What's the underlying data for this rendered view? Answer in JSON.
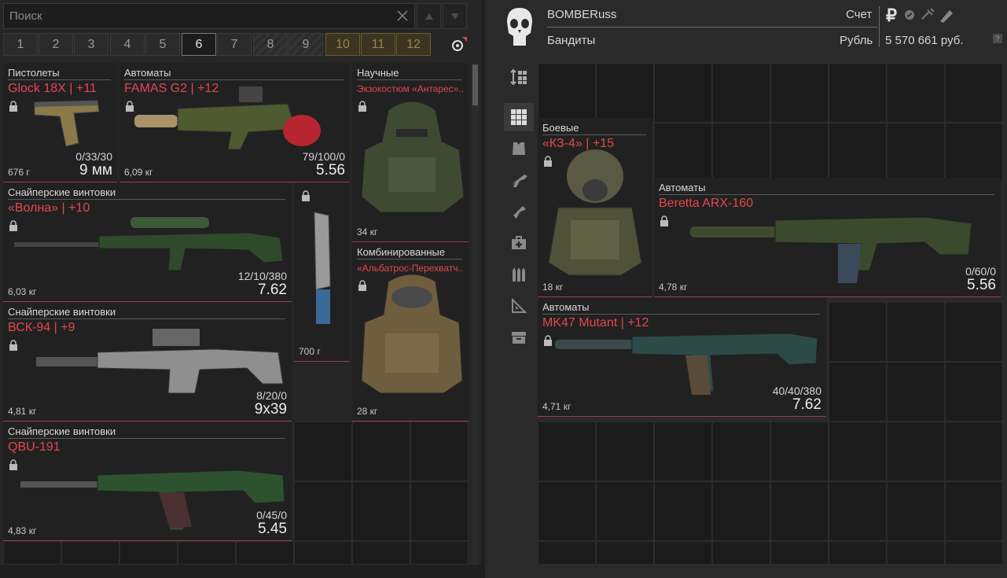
{
  "search": {
    "placeholder": "Поиск"
  },
  "tabs": [
    "1",
    "2",
    "3",
    "4",
    "5",
    "6",
    "7",
    "8",
    "9",
    "10",
    "11",
    "12"
  ],
  "active_tab": "6",
  "icons": {
    "clear": "close-icon",
    "sort_up": "triangle-up-icon",
    "sort_down": "triangle-down-icon",
    "filter": "target-filter-icon",
    "emblem": "skull-icon",
    "ruble": "ruble-icon",
    "help": "help-icon"
  },
  "left_items": [
    {
      "id": "glock",
      "category": "Пистолеты",
      "name": "Glock 18X | +11",
      "weight": "676 г",
      "ammo": "0/33/30",
      "caliber": "9 мм"
    },
    {
      "id": "famas",
      "category": "Автоматы",
      "name": "FAMAS G2 | +12",
      "weight": "6,09 кг",
      "ammo": "79/100/0",
      "caliber": "5.56"
    },
    {
      "id": "antares",
      "category": "Научные",
      "name": "Экзокостюм «Антарес»..",
      "weight": "34 кг"
    },
    {
      "id": "volna",
      "category": "Снайперские винтовки",
      "name": "«Волна» | +10",
      "weight": "6,03 кг",
      "ammo": "12/10/380",
      "caliber": "7.62"
    },
    {
      "id": "knife",
      "category": "",
      "name": "",
      "weight": "700 г"
    },
    {
      "id": "albatros",
      "category": "Комбинированные",
      "name": "«Альбатрос-Перехватч..",
      "weight": "28 кг"
    },
    {
      "id": "vsk94",
      "category": "Снайперские винтовки",
      "name": "ВСК-94 | +9",
      "weight": "4,81 кг",
      "ammo": "8/20/0",
      "caliber": "9x39"
    },
    {
      "id": "qbu191",
      "category": "Снайперские винтовки",
      "name": "QBU-191",
      "weight": "4,83 кг",
      "ammo": "0/45/0",
      "caliber": "5.45"
    }
  ],
  "player": {
    "name": "BOMBERuss",
    "clan": "Бандиты",
    "account_label": "Счет",
    "currency_label": "Рубль",
    "currency_symbol": "₽",
    "balance": "5 570 661 руб.",
    "help": "?"
  },
  "side_toolbar": [
    "sort-icon",
    "grid-icon",
    "armor-icon",
    "rifle-icon",
    "pistol-icon",
    "medkit-icon",
    "ammo-icon",
    "ruler-icon",
    "box-icon"
  ],
  "right_items": [
    {
      "id": "kz4",
      "category": "Боевые",
      "name": "«КЗ-4» | +15",
      "weight": "18 кг"
    },
    {
      "id": "arx160",
      "category": "Автоматы",
      "name": "Beretta ARX-160",
      "weight": "4,78 кг",
      "ammo": "0/60/0",
      "caliber": "5.56"
    },
    {
      "id": "mk47",
      "category": "Автоматы",
      "name": "MK47 Mutant | +12",
      "weight": "4,71 кг",
      "ammo": "40/40/380",
      "caliber": "7.62"
    }
  ]
}
